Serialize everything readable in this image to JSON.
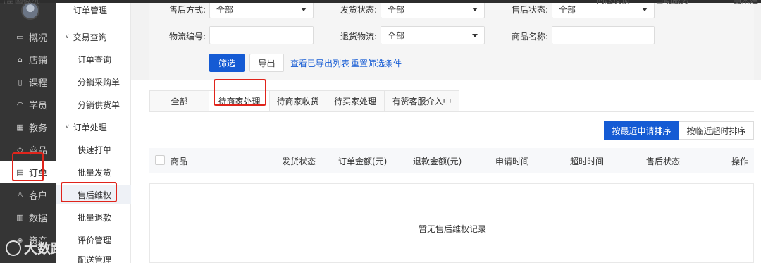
{
  "topbar": {
    "left_fragment": "(富画概况",
    "right_fragments": [
      "问题反馈",
      "自助服务",
      "晶米建"
    ]
  },
  "primary_nav": [
    {
      "label": "概况",
      "icon": "dashboard-icon"
    },
    {
      "label": "店铺",
      "icon": "store-icon"
    },
    {
      "label": "课程",
      "icon": "book-icon"
    },
    {
      "label": "学员",
      "icon": "user-icon"
    },
    {
      "label": "教务",
      "icon": "calendar-icon"
    },
    {
      "label": "商品",
      "icon": "tag-icon"
    },
    {
      "label": "订单",
      "icon": "order-icon"
    },
    {
      "label": "客户",
      "icon": "customer-icon"
    },
    {
      "label": "数据",
      "icon": "chart-icon"
    },
    {
      "label": "资产",
      "icon": "wallet-icon"
    }
  ],
  "secondary_nav": {
    "top_item": "订单管理",
    "group1": "交易查询",
    "group1_items": [
      "订单查询",
      "分销采购单",
      "分销供货单"
    ],
    "group2": "订单处理",
    "group2_items": [
      "快速打单",
      "批量发货",
      "售后维权",
      "批量退款",
      "评价管理",
      "配送管理"
    ]
  },
  "filters": {
    "row1": [
      {
        "label": "售后方式:",
        "value": "全部"
      },
      {
        "label": "发货状态:",
        "value": "全部"
      },
      {
        "label": "售后状态:",
        "value": "全部"
      }
    ],
    "row2": {
      "logistics_label": "物流编号:",
      "logistics_value": "",
      "return_label": "退货物流:",
      "return_value": "全部",
      "product_label": "商品名称:",
      "product_value": ""
    },
    "filter_button": "筛选",
    "export_button": "导出",
    "view_exported_link": "查看已导出列表",
    "reset_link": "重置筛选条件"
  },
  "tabs": [
    "全部",
    "待商家处理",
    "待商家收货",
    "待买家处理",
    "有赞客服介入中"
  ],
  "active_tab": "待商家处理",
  "sort": {
    "recent_apply": "按最近申请排序",
    "near_timeout": "按临近超时排序"
  },
  "table": {
    "columns": [
      "商品",
      "发货状态",
      "订单金额(元)",
      "退款金额(元)",
      "申请时间",
      "超时时间",
      "售后状态",
      "操作"
    ],
    "empty_text": "暂无售后维权记录"
  },
  "watermark": "大数跨境",
  "colors": {
    "primary": "#155bd4",
    "sidebar_dark": "#353535",
    "highlight": "#e0241b"
  }
}
